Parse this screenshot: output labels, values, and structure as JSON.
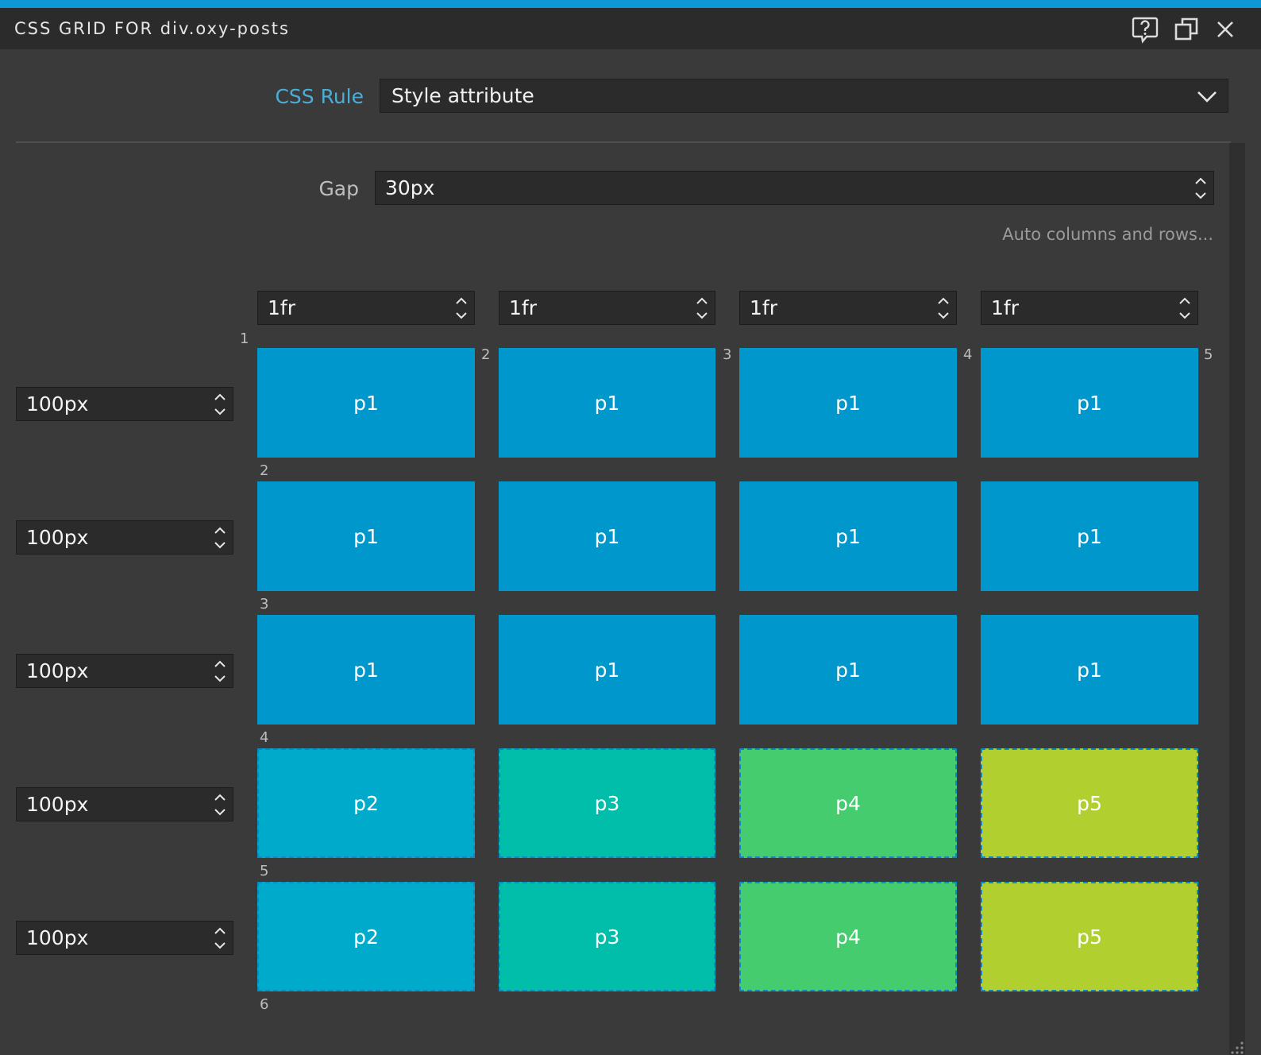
{
  "panel": {
    "title": "CSS GRID FOR div.oxy-posts",
    "help_icon": "help-speech-icon",
    "popout_icon": "popout-window-icon",
    "close_icon": "close-icon"
  },
  "css_rule": {
    "label": "CSS Rule",
    "value": "Style attribute"
  },
  "gap": {
    "label": "Gap",
    "value": "30px"
  },
  "auto_link": "Auto columns and rows...",
  "columns": [
    "1fr",
    "1fr",
    "1fr",
    "1fr"
  ],
  "rows": [
    "100px",
    "100px",
    "100px",
    "100px",
    "100px"
  ],
  "column_lines": [
    "1",
    "2",
    "3",
    "4",
    "5"
  ],
  "row_lines": [
    "2",
    "3",
    "4",
    "5",
    "6"
  ],
  "cells": [
    [
      "p1",
      "p1",
      "p1",
      "p1"
    ],
    [
      "p1",
      "p1",
      "p1",
      "p1"
    ],
    [
      "p1",
      "p1",
      "p1",
      "p1"
    ],
    [
      "p2",
      "p3",
      "p4",
      "p5"
    ],
    [
      "p2",
      "p3",
      "p4",
      "p5"
    ]
  ],
  "colors": {
    "accent": "#0e97d4",
    "p1": "#0097cc",
    "p2": "#00aacb",
    "p3": "#00bea9",
    "p4": "#45cc6e",
    "p5": "#b1d02f"
  }
}
